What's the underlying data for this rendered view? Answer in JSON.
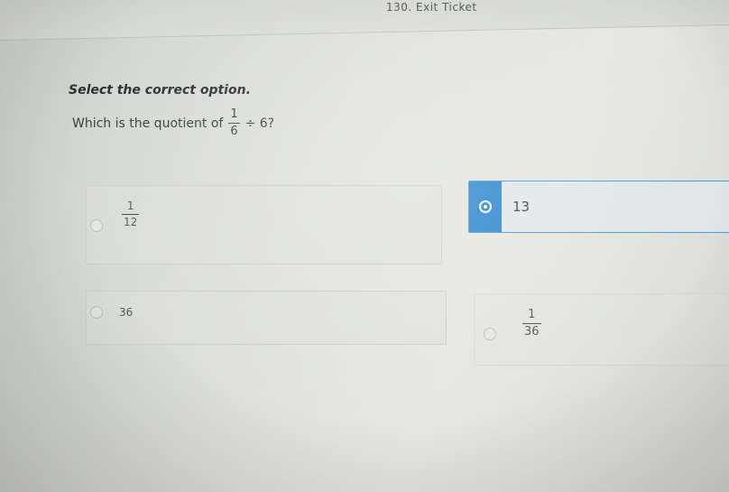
{
  "header": {
    "title": "130. Exit Ticket"
  },
  "instruction": "Select the correct option.",
  "question": {
    "prefix": "Which is the quotient of",
    "fraction": {
      "numerator": "1",
      "denominator": "6"
    },
    "suffix": "÷ 6?"
  },
  "options": [
    {
      "id": "a",
      "numerator": "1",
      "denominator": "12",
      "selected": false
    },
    {
      "id": "b",
      "label": "1̸̸̸",
      "display": "13",
      "selected": true
    },
    {
      "id": "c",
      "label": "36",
      "selected": false
    },
    {
      "id": "d",
      "numerator": "1",
      "denominator": "36",
      "selected": false
    }
  ],
  "colors": {
    "selected_accent": "#2b86cf",
    "text": "#3a3d40"
  }
}
